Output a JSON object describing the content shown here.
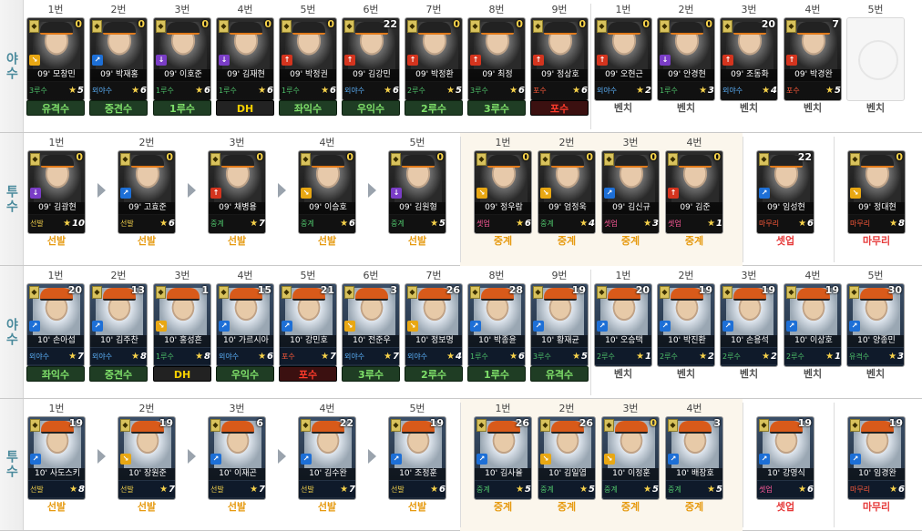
{
  "sections": [
    {
      "label": "야수",
      "type": "batter",
      "year": "09",
      "slots": [
        {
          "pos": "1번",
          "name": "09' 모창민",
          "lvl": "0",
          "icon": "yellow",
          "role": "3루수",
          "rv": "5",
          "rc": "green",
          "field": "유격수",
          "fc": "green"
        },
        {
          "pos": "2번",
          "name": "09' 박재홍",
          "lvl": "0",
          "icon": "blue",
          "role": "외야수",
          "rv": "6",
          "rc": "blue",
          "field": "중견수",
          "fc": "green"
        },
        {
          "pos": "3번",
          "name": "09' 이호준",
          "lvl": "0",
          "icon": "purple",
          "role": "1루수",
          "rv": "6",
          "rc": "green",
          "field": "1루수",
          "fc": "green"
        },
        {
          "pos": "4번",
          "name": "09' 김재현",
          "lvl": "0",
          "icon": "purple",
          "role": "1루수",
          "rv": "6",
          "rc": "green",
          "field": "DH",
          "fc": "dark"
        },
        {
          "pos": "5번",
          "name": "09' 박정권",
          "lvl": "0",
          "icon": "red",
          "role": "1루수",
          "rv": "6",
          "rc": "green",
          "field": "좌익수",
          "fc": "green"
        },
        {
          "pos": "6번",
          "name": "09' 김강민",
          "lvl": "22",
          "icon": "red",
          "role": "외야수",
          "rv": "6",
          "rc": "blue",
          "field": "우익수",
          "fc": "green"
        },
        {
          "pos": "7번",
          "name": "09' 박정환",
          "lvl": "0",
          "icon": "red",
          "role": "2루수",
          "rv": "5",
          "rc": "green",
          "field": "2루수",
          "fc": "green"
        },
        {
          "pos": "8번",
          "name": "09' 최정",
          "lvl": "0",
          "icon": "red",
          "role": "3루수",
          "rv": "6",
          "rc": "green",
          "field": "3루수",
          "fc": "green"
        },
        {
          "pos": "9번",
          "name": "09' 정상호",
          "lvl": "0",
          "icon": "red",
          "role": "포수",
          "rv": "6",
          "rc": "red",
          "field": "포수",
          "fc": "red"
        },
        {
          "pos": "1번",
          "name": "09' 오현근",
          "lvl": "0",
          "icon": "red",
          "role": "외야수",
          "rv": "2",
          "rc": "blue",
          "field": "벤치",
          "fc": "bench"
        },
        {
          "pos": "2번",
          "name": "09' 안경현",
          "lvl": "0",
          "icon": "purple",
          "role": "1루수",
          "rv": "3",
          "rc": "green",
          "field": "벤치",
          "fc": "bench"
        },
        {
          "pos": "3번",
          "name": "09' 조동화",
          "lvl": "20",
          "icon": "red",
          "role": "외야수",
          "rv": "4",
          "rc": "blue",
          "field": "벤치",
          "fc": "bench"
        },
        {
          "pos": "4번",
          "name": "09' 박경완",
          "lvl": "7",
          "icon": "red",
          "role": "포수",
          "rv": "5",
          "rc": "red",
          "field": "벤치",
          "fc": "bench"
        },
        {
          "pos": "5번",
          "empty": true,
          "field": "벤치",
          "fc": "bench"
        }
      ]
    },
    {
      "label": "투수",
      "type": "pitcher",
      "year": "09",
      "slots": [
        {
          "pos": "1번",
          "name": "09' 김광현",
          "lvl": "0",
          "icon": "purple",
          "role": "선발",
          "rv": "10",
          "rc": "yel",
          "field": "선발",
          "fc": "orange"
        },
        {
          "pos": "2번",
          "name": "09' 고효준",
          "lvl": "0",
          "icon": "blue",
          "role": "선발",
          "rv": "6",
          "rc": "yel",
          "field": "선발",
          "fc": "orange"
        },
        {
          "pos": "3번",
          "name": "09' 채병용",
          "lvl": "0",
          "icon": "red",
          "role": "중계",
          "rv": "7",
          "rc": "green",
          "field": "선발",
          "fc": "orange"
        },
        {
          "pos": "4번",
          "name": "09' 이승호",
          "lvl": "0",
          "icon": "yellow",
          "role": "중계",
          "rv": "6",
          "rc": "green",
          "field": "선발",
          "fc": "orange"
        },
        {
          "pos": "5번",
          "name": "09' 김원형",
          "lvl": "0",
          "icon": "purple",
          "role": "중계",
          "rv": "5",
          "rc": "green",
          "field": "선발",
          "fc": "orange"
        },
        {
          "pos": "1번",
          "name": "09' 정우람",
          "lvl": "0",
          "icon": "yellow",
          "role": "셋업",
          "rv": "6",
          "rc": "pink",
          "field": "중계",
          "fc": "orange"
        },
        {
          "pos": "2번",
          "name": "09' 엄정욱",
          "lvl": "0",
          "icon": "yellow",
          "role": "중계",
          "rv": "4",
          "rc": "green",
          "field": "중계",
          "fc": "orange"
        },
        {
          "pos": "3번",
          "name": "09' 김신규",
          "lvl": "0",
          "icon": "blue",
          "role": "셋업",
          "rv": "3",
          "rc": "pink",
          "field": "중계",
          "fc": "orange"
        },
        {
          "pos": "4번",
          "name": "09' 김준",
          "lvl": "0",
          "icon": "red",
          "role": "셋업",
          "rv": "1",
          "rc": "pink",
          "field": "중계",
          "fc": "orange"
        },
        {
          "pos": "",
          "name": "09' 임성현",
          "lvl": "22",
          "icon": "blue",
          "role": "마무리",
          "rv": "6",
          "rc": "red",
          "field": "셋업",
          "fc": "pink"
        },
        {
          "pos": "",
          "name": "09' 정대현",
          "lvl": "0",
          "icon": "yellow",
          "role": "마무리",
          "rv": "8",
          "rc": "red",
          "field": "마무리",
          "fc": "pink"
        }
      ]
    },
    {
      "label": "야수",
      "type": "batter",
      "year": "10",
      "slots": [
        {
          "pos": "1번",
          "name": "10' 손아섭",
          "lvl": "20",
          "icon": "blue",
          "role": "외야수",
          "rv": "7",
          "rc": "blue",
          "field": "좌익수",
          "fc": "green"
        },
        {
          "pos": "2번",
          "name": "10' 김주찬",
          "lvl": "13",
          "icon": "blue",
          "role": "외야수",
          "rv": "8",
          "rc": "blue",
          "field": "중견수",
          "fc": "green"
        },
        {
          "pos": "3번",
          "name": "10' 홍성흔",
          "lvl": "1",
          "icon": "yellow",
          "role": "1루수",
          "rv": "8",
          "rc": "green",
          "field": "DH",
          "fc": "dark"
        },
        {
          "pos": "4번",
          "name": "10' 가르시아",
          "lvl": "15",
          "icon": "blue",
          "role": "외야수",
          "rv": "6",
          "rc": "blue",
          "field": "우익수",
          "fc": "green"
        },
        {
          "pos": "5번",
          "name": "10' 강민호",
          "lvl": "21",
          "icon": "blue",
          "role": "포수",
          "rv": "7",
          "rc": "red",
          "field": "포수",
          "fc": "red"
        },
        {
          "pos": "6번",
          "name": "10' 전준우",
          "lvl": "3",
          "icon": "yellow",
          "role": "외야수",
          "rv": "7",
          "rc": "blue",
          "field": "3루수",
          "fc": "green"
        },
        {
          "pos": "7번",
          "name": "10' 정보명",
          "lvl": "26",
          "icon": "yellow",
          "role": "외야수",
          "rv": "4",
          "rc": "blue",
          "field": "2루수",
          "fc": "green"
        },
        {
          "pos": "8번",
          "name": "10' 박종윤",
          "lvl": "28",
          "icon": "blue",
          "role": "1루수",
          "rv": "6",
          "rc": "green",
          "field": "1루수",
          "fc": "green"
        },
        {
          "pos": "9번",
          "name": "10' 황재균",
          "lvl": "19",
          "icon": "blue",
          "role": "3루수",
          "rv": "5",
          "rc": "green",
          "field": "유격수",
          "fc": "green"
        },
        {
          "pos": "1번",
          "name": "10' 오승택",
          "lvl": "20",
          "icon": "blue",
          "role": "2루수",
          "rv": "1",
          "rc": "green",
          "field": "벤치",
          "fc": "bench"
        },
        {
          "pos": "2번",
          "name": "10' 박진환",
          "lvl": "19",
          "icon": "blue",
          "role": "2루수",
          "rv": "2",
          "rc": "green",
          "field": "벤치",
          "fc": "bench"
        },
        {
          "pos": "3번",
          "name": "10' 손용석",
          "lvl": "19",
          "icon": "blue",
          "role": "2루수",
          "rv": "2",
          "rc": "green",
          "field": "벤치",
          "fc": "bench"
        },
        {
          "pos": "4번",
          "name": "10' 이상호",
          "lvl": "19",
          "icon": "blue",
          "role": "2루수",
          "rv": "1",
          "rc": "green",
          "field": "벤치",
          "fc": "bench"
        },
        {
          "pos": "5번",
          "name": "10' 양종민",
          "lvl": "30",
          "icon": "blue",
          "role": "유격수",
          "rv": "3",
          "rc": "green",
          "field": "벤치",
          "fc": "bench"
        }
      ]
    },
    {
      "label": "투수",
      "type": "pitcher",
      "year": "10",
      "slots": [
        {
          "pos": "1번",
          "name": "10' 사도스키",
          "lvl": "19",
          "icon": "blue",
          "role": "선발",
          "rv": "8",
          "rc": "yel",
          "field": "선발",
          "fc": "orange"
        },
        {
          "pos": "2번",
          "name": "10' 장원준",
          "lvl": "19",
          "icon": "yellow",
          "role": "선발",
          "rv": "7",
          "rc": "yel",
          "field": "선발",
          "fc": "orange"
        },
        {
          "pos": "3번",
          "name": "10' 이재곤",
          "lvl": "6",
          "icon": "blue",
          "role": "선발",
          "rv": "7",
          "rc": "yel",
          "field": "선발",
          "fc": "orange"
        },
        {
          "pos": "4번",
          "name": "10' 김수완",
          "lvl": "22",
          "icon": "blue",
          "role": "선발",
          "rv": "7",
          "rc": "yel",
          "field": "선발",
          "fc": "orange"
        },
        {
          "pos": "5번",
          "name": "10' 조정훈",
          "lvl": "19",
          "icon": "blue",
          "role": "선발",
          "rv": "6",
          "rc": "yel",
          "field": "선발",
          "fc": "orange"
        },
        {
          "pos": "1번",
          "name": "10' 김사율",
          "lvl": "26",
          "icon": "blue",
          "role": "중계",
          "rv": "5",
          "rc": "green",
          "field": "중계",
          "fc": "orange"
        },
        {
          "pos": "2번",
          "name": "10' 김일엽",
          "lvl": "26",
          "icon": "yellow",
          "role": "중계",
          "rv": "5",
          "rc": "green",
          "field": "중계",
          "fc": "orange"
        },
        {
          "pos": "3번",
          "name": "10' 이정훈",
          "lvl": "0",
          "icon": "yellow",
          "role": "중계",
          "rv": "5",
          "rc": "green",
          "field": "중계",
          "fc": "orange"
        },
        {
          "pos": "4번",
          "name": "10' 배장호",
          "lvl": "3",
          "icon": "blue",
          "role": "중계",
          "rv": "5",
          "rc": "green",
          "field": "중계",
          "fc": "orange"
        },
        {
          "pos": "",
          "name": "10' 강영식",
          "lvl": "19",
          "icon": "blue",
          "role": "셋업",
          "rv": "6",
          "rc": "pink",
          "field": "셋업",
          "fc": "pink"
        },
        {
          "pos": "",
          "name": "10' 임경완",
          "lvl": "19",
          "icon": "blue",
          "role": "마무리",
          "rv": "6",
          "rc": "red",
          "field": "마무리",
          "fc": "pink"
        }
      ]
    }
  ]
}
